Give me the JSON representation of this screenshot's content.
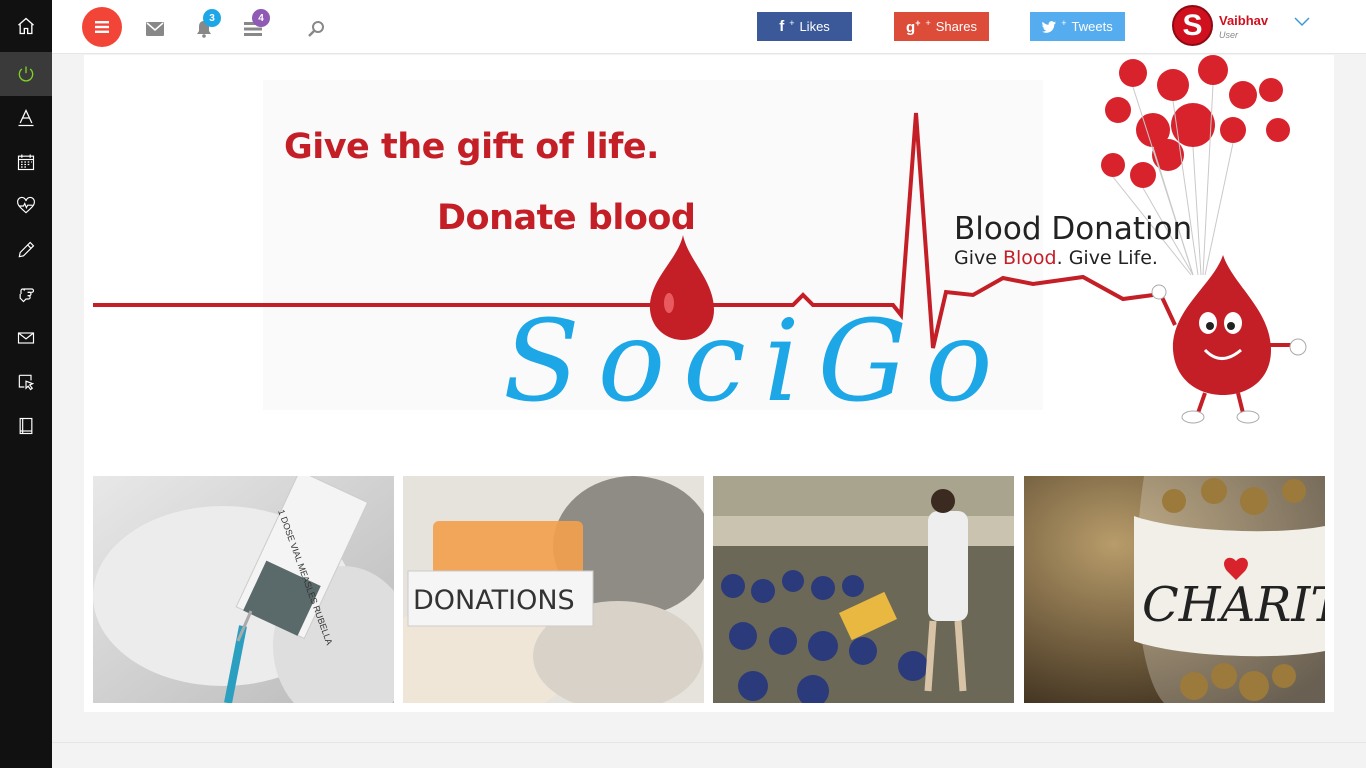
{
  "sidebar": {
    "items": [
      {
        "name": "home-icon"
      },
      {
        "name": "power-icon"
      },
      {
        "name": "text-icon"
      },
      {
        "name": "calendar-icon"
      },
      {
        "name": "heartbeat-icon"
      },
      {
        "name": "pencil-icon"
      },
      {
        "name": "hand-pointer-icon"
      },
      {
        "name": "mail-icon"
      },
      {
        "name": "cursor-select-icon"
      },
      {
        "name": "book-icon"
      }
    ]
  },
  "topbar": {
    "notifications_count": "3",
    "tasks_count": "4",
    "social": {
      "likes_label": "Likes",
      "shares_label": "Shares",
      "tweets_label": "Tweets"
    },
    "user": {
      "initial": "S",
      "name": "Vaibhav",
      "role": "User"
    }
  },
  "banner": {
    "headline": "Give the gift of life.",
    "subheadline": "Donate blood",
    "title": "Blood Donation",
    "tagline_part1": "Give ",
    "tagline_highlight": "Blood",
    "tagline_part2": ". Give Life.",
    "brand": "SociGo"
  },
  "photos": [
    {
      "name": "vaccine-photo",
      "label": "1 DOSE VIAL MEASLES RUBELLA"
    },
    {
      "name": "donations-photo",
      "label": "DONATIONS"
    },
    {
      "name": "school-children-photo",
      "label": ""
    },
    {
      "name": "charity-jar-photo",
      "label": "CHARITY"
    }
  ],
  "colors": {
    "accent_red": "#f24537",
    "brand_red": "#d0101e",
    "facebook": "#3b5998",
    "google_plus": "#dd4b39",
    "twitter": "#55acee",
    "socigo_blue": "#1ea7e6",
    "badge_blue": "#1ea7e6",
    "badge_purple": "#8e5ab5"
  }
}
